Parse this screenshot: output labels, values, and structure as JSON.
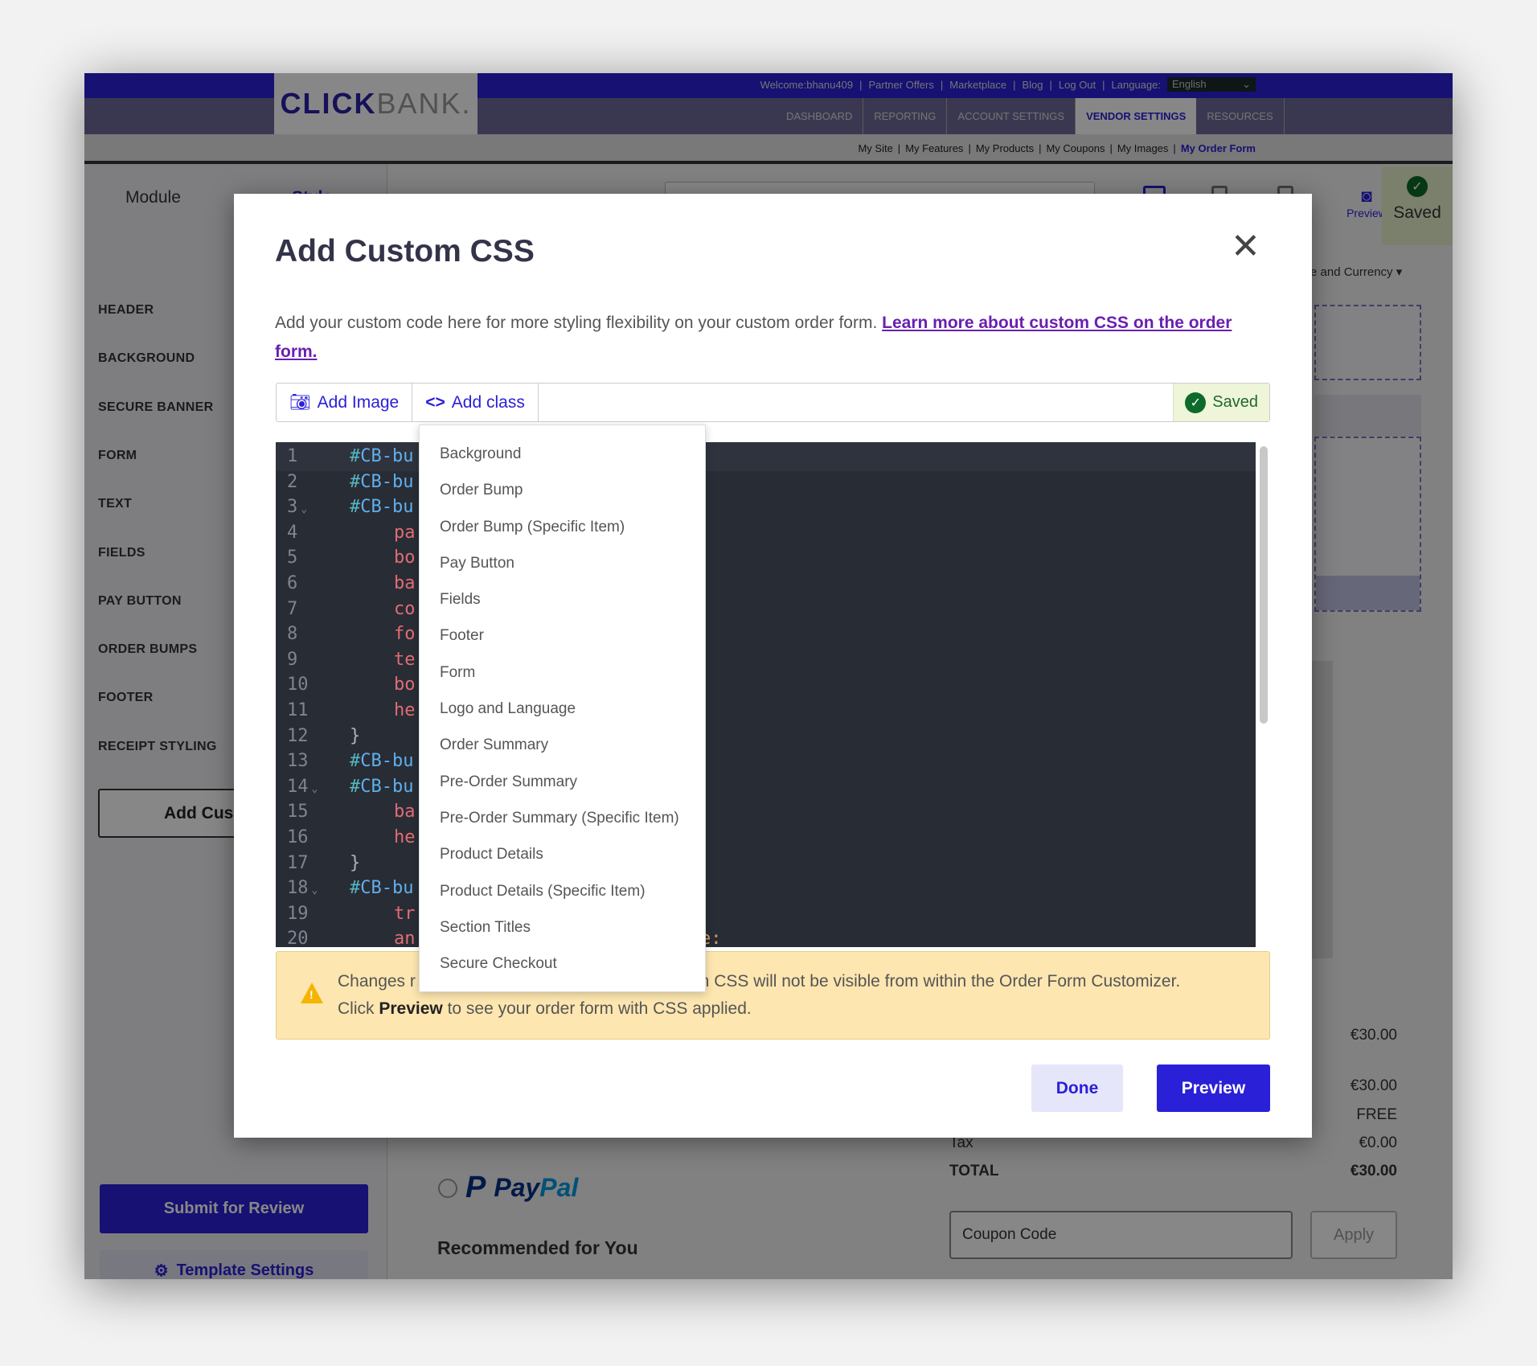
{
  "header": {
    "logo": {
      "part1": "CLICK",
      "part2": "BANK."
    },
    "top_links": [
      "Welcome:bhanu409",
      "|",
      "Partner Offers",
      "|",
      "Marketplace",
      "|",
      "Blog",
      "|",
      "Log Out",
      "|",
      "Language:"
    ],
    "language": {
      "selected": "English"
    },
    "main_nav": [
      "DASHBOARD",
      "REPORTING",
      "ACCOUNT SETTINGS",
      "VENDOR SETTINGS",
      "RESOURCES"
    ],
    "main_nav_active": "VENDOR SETTINGS",
    "sub_nav": [
      "My Site",
      "|",
      "My Features",
      "|",
      "My Products",
      "|",
      "My Coupons",
      "|",
      "My Images",
      "|",
      "My Order Form"
    ],
    "sub_nav_active": "My Order Form"
  },
  "sidebar": {
    "tabs": [
      "Module",
      "Style"
    ],
    "items": [
      "HEADER",
      "BACKGROUND",
      "SECURE BANNER",
      "FORM",
      "TEXT",
      "FIELDS",
      "PAY BUTTON",
      "ORDER BUMPS",
      "FOOTER",
      "RECEIPT STYLING"
    ],
    "add_custom_label": "Add Cus",
    "submit_label": "Submit for Review",
    "template_settings_label": "Template Settings"
  },
  "toolbar_right": {
    "preview_label": "Preview",
    "saved_label": "Saved",
    "currency_label": "e and Currency"
  },
  "order_summary": {
    "subtotal_top": "€30.00",
    "rows": [
      {
        "label": "",
        "value": "€30.00"
      },
      {
        "label": "",
        "value": "FREE"
      },
      {
        "label": "Tax",
        "value": "€0.00"
      },
      {
        "label": "TOTAL",
        "value": "€30.00"
      }
    ],
    "coupon_placeholder": "Coupon Code",
    "apply_label": "Apply"
  },
  "payment": {
    "paypal_part1": "Pay",
    "paypal_part2": "Pal"
  },
  "recommended_title": "Recommended for You",
  "modal": {
    "title": "Add Custom CSS",
    "description": "Add your custom code here for more styling flexibility on your custom order form.",
    "learn_more_link": "Learn more about custom CSS on the order form.",
    "add_image_label": "Add Image",
    "add_class_label": "Add class",
    "saved_label": "Saved",
    "code_lines": [
      {
        "n": "1",
        "fold": "",
        "hash": "#",
        "sel": "CB-bu",
        "prop": "",
        "brace": "",
        "indent": 0
      },
      {
        "n": "2",
        "fold": "",
        "hash": "#",
        "sel": "CB-bu",
        "prop": "",
        "brace": "",
        "indent": 0
      },
      {
        "n": "3",
        "fold": "⌄",
        "hash": "#",
        "sel": "CB-bu",
        "prop": "",
        "brace": "",
        "indent": 0
      },
      {
        "n": "4",
        "fold": "",
        "hash": "",
        "sel": "",
        "prop": "pa",
        "brace": "",
        "indent": 1
      },
      {
        "n": "5",
        "fold": "",
        "hash": "",
        "sel": "",
        "prop": "bo",
        "brace": "",
        "indent": 1
      },
      {
        "n": "6",
        "fold": "",
        "hash": "",
        "sel": "",
        "prop": "ba",
        "brace": "",
        "indent": 1
      },
      {
        "n": "7",
        "fold": "",
        "hash": "",
        "sel": "",
        "prop": "co",
        "brace": "",
        "indent": 1
      },
      {
        "n": "8",
        "fold": "",
        "hash": "",
        "sel": "",
        "prop": "fo",
        "brace": "",
        "indent": 1
      },
      {
        "n": "9",
        "fold": "",
        "hash": "",
        "sel": "",
        "prop": "te",
        "brace": "",
        "indent": 1
      },
      {
        "n": "10",
        "fold": "",
        "hash": "",
        "sel": "",
        "prop": "bo",
        "brace": "",
        "indent": 1
      },
      {
        "n": "11",
        "fold": "",
        "hash": "",
        "sel": "",
        "prop": "he",
        "brace": "",
        "indent": 1
      },
      {
        "n": "12",
        "fold": "",
        "hash": "",
        "sel": "",
        "prop": "",
        "brace": "}",
        "indent": 0
      },
      {
        "n": "13",
        "fold": "",
        "hash": "#",
        "sel": "CB-bu",
        "prop": "",
        "brace": "",
        "indent": 0
      },
      {
        "n": "14",
        "fold": "⌄",
        "hash": "#",
        "sel": "CB-bu",
        "prop": "",
        "brace": "",
        "indent": 0
      },
      {
        "n": "15",
        "fold": "",
        "hash": "",
        "sel": "",
        "prop": "ba",
        "brace": "",
        "indent": 1
      },
      {
        "n": "16",
        "fold": "",
        "hash": "",
        "sel": "",
        "prop": "he",
        "brace": "",
        "indent": 1
      },
      {
        "n": "17",
        "fold": "",
        "hash": "",
        "sel": "",
        "prop": "",
        "brace": "}",
        "indent": 0
      },
      {
        "n": "18",
        "fold": "⌄",
        "hash": "#",
        "sel": "CB-bu",
        "prop": "",
        "brace": "",
        "indent": 0
      },
      {
        "n": "19",
        "fold": "",
        "hash": "",
        "sel": "",
        "prop": "tr",
        "brace": "",
        "indent": 1
      },
      {
        "n": "20",
        "fold": "",
        "hash": "",
        "sel": "",
        "prop": "an",
        "brace": "",
        "indent": 1
      }
    ],
    "line20_tail": "e:",
    "class_menu": [
      "Background",
      "Order Bump",
      "Order Bump (Specific Item)",
      "Pay Button",
      "Fields",
      "Footer",
      "Form",
      "Logo and Language",
      "Order Summary",
      "Pre-Order Summary",
      "Pre-Order Summary (Specific Item)",
      "Product Details",
      "Product Details (Specific Item)",
      "Section Titles",
      "Secure Checkout"
    ],
    "warning": {
      "line1_start": "Changes r",
      "line1_end": "stom CSS will not be visible from within the Order Form Customizer.",
      "line2_pre": "Click",
      "line2_bold": "Preview",
      "line2_post": "to see your order form with CSS applied."
    },
    "done_label": "Done",
    "preview_label": "Preview"
  },
  "colors": {
    "brand": "#2a20d8",
    "link": "#6a1fb0",
    "warning_bg": "#fde6b0",
    "saved_green": "#0d6a2a",
    "editor_bg": "#282c34"
  }
}
